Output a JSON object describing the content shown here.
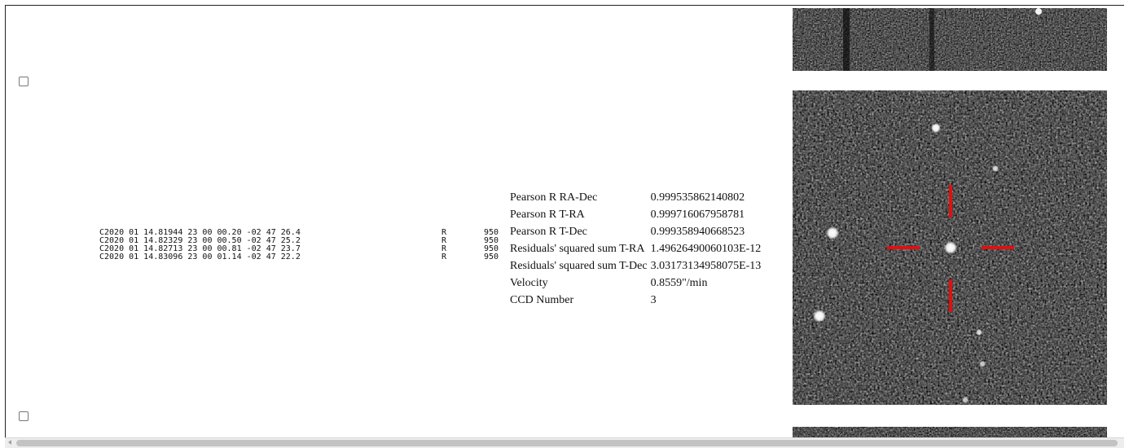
{
  "observations": [
    {
      "line": "C2020 01 14.81944 23 00 00.20 -02 47 26.4",
      "band": "R",
      "code": "950"
    },
    {
      "line": "C2020 01 14.82329 23 00 00.50 -02 47 25.2",
      "band": "R",
      "code": "950"
    },
    {
      "line": "C2020 01 14.82713 23 00 00.81 -02 47 23.7",
      "band": "R",
      "code": "950"
    },
    {
      "line": "C2020 01 14.83096 23 00 01.14 -02 47 22.2",
      "band": "R",
      "code": "950"
    }
  ],
  "stats": [
    {
      "label": "Pearson R RA-Dec",
      "value": "0.999535862140802"
    },
    {
      "label": "Pearson R T-RA",
      "value": "0.999716067958781"
    },
    {
      "label": "Pearson R T-Dec",
      "value": "0.999358940668523"
    },
    {
      "label": "Residuals' squared sum T-RA",
      "value": "1.49626490060103E-12"
    },
    {
      "label": "Residuals' squared sum T-Dec",
      "value": "3.03173134958075E-13"
    },
    {
      "label": "Velocity",
      "value": "0.8559\"/min"
    },
    {
      "label": "CCD Number",
      "value": "3"
    }
  ],
  "images": {
    "main_marker_color": "#e01010",
    "background_color": "#121212"
  }
}
